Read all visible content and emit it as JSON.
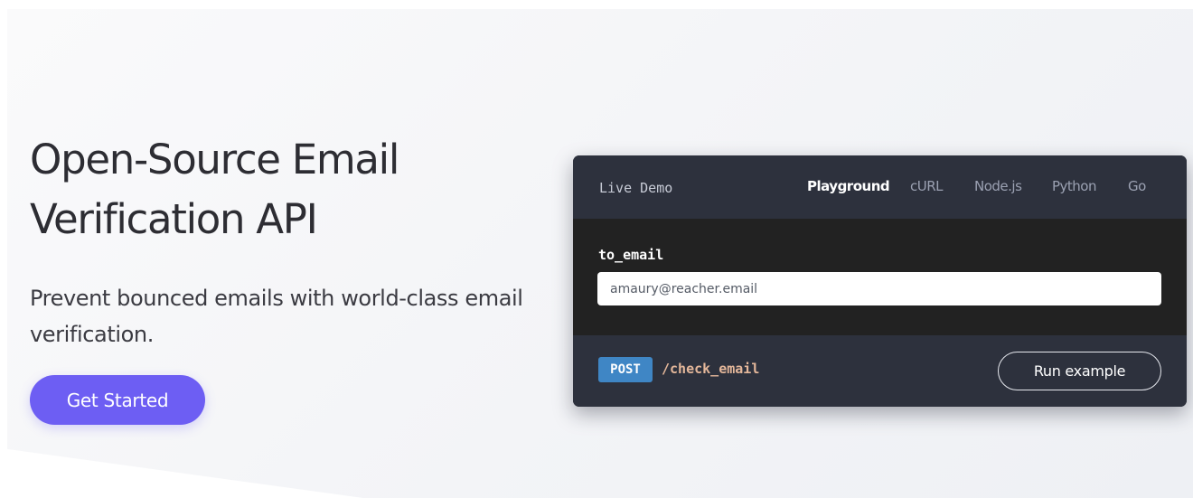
{
  "hero": {
    "title": "Open-Source Email Verification API",
    "subtitle": "Prevent bounced emails with world-class email verification.",
    "cta_label": "Get Started"
  },
  "demo": {
    "title": "Live Demo",
    "tabs": [
      {
        "label": "Playground",
        "active": true
      },
      {
        "label": "cURL",
        "active": false
      },
      {
        "label": "Node.js",
        "active": false
      },
      {
        "label": "Python",
        "active": false
      },
      {
        "label": "Go",
        "active": false
      }
    ],
    "field_label": "to_email",
    "email_value": "amaury@reacher.email",
    "method": "POST",
    "endpoint": "/check_email",
    "run_label": "Run example"
  },
  "colors": {
    "accent": "#6d5ef3",
    "panel_dark": "#22252d",
    "panel_header": "#2d313d",
    "method_badge": "#3f86c5",
    "endpoint_text": "#e4b79a"
  }
}
